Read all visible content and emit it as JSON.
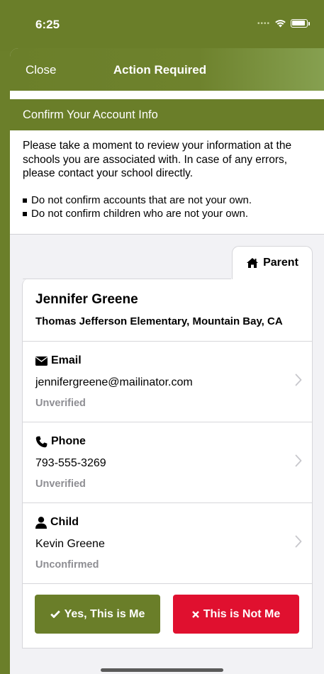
{
  "status_bar": {
    "time": "6:25",
    "signal_icon": "signal-dots-icon",
    "wifi_icon": "wifi-icon",
    "battery_icon": "battery-icon"
  },
  "nav": {
    "close_label": "Close",
    "title": "Action Required"
  },
  "section": {
    "title": "Confirm Your Account Info",
    "intro": "Please take a moment to review your information at the schools you are associated with. In case of any errors, please contact your school directly.",
    "bullets": [
      "Do not confirm accounts that are not your own.",
      "Do not confirm children who are not your own."
    ]
  },
  "tab": {
    "label": "Parent",
    "icon": "home-icon"
  },
  "account": {
    "name": "Jennifer Greene",
    "school": "Thomas Jefferson Elementary, Mountain Bay, CA",
    "rows": [
      {
        "label": "Email",
        "icon": "envelope-icon",
        "value": "jennifergreene@mailinator.com",
        "status": "Unverified"
      },
      {
        "label": "Phone",
        "icon": "phone-icon",
        "value": "793-555-3269",
        "status": "Unverified"
      },
      {
        "label": "Child",
        "icon": "person-icon",
        "value": "Kevin Greene",
        "status": "Unconfirmed"
      }
    ]
  },
  "actions": {
    "yes_label": "Yes, This is Me",
    "no_label": "This is Not Me"
  },
  "colors": {
    "brand_green": "#6a7e29",
    "danger_red": "#e0102f",
    "muted_text": "#8e8e93"
  }
}
